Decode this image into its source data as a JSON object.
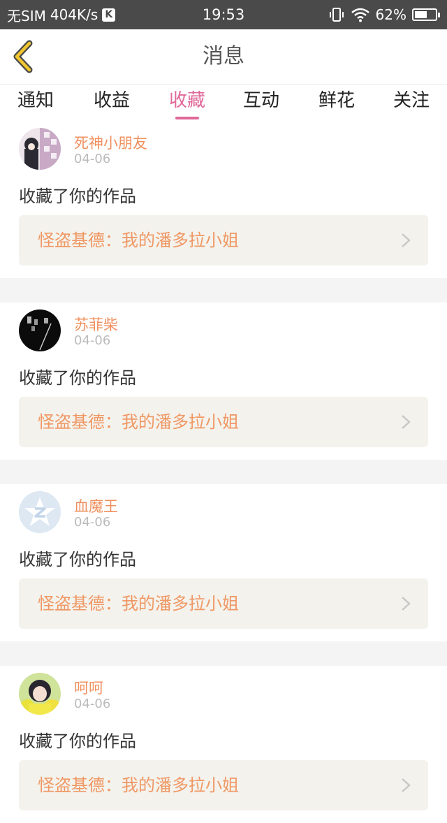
{
  "status_bar": {
    "carrier": "无SIM",
    "speed": "404K/s",
    "k_badge": "K",
    "time": "19:53",
    "battery": "62%",
    "battery_level": 0.62
  },
  "header": {
    "title": "消息",
    "back_icon": "chevron-left-icon",
    "accent_color": "#f2c62f"
  },
  "tabs": [
    {
      "label": "通知",
      "active": false
    },
    {
      "label": "收益",
      "active": false
    },
    {
      "label": "收藏",
      "active": true
    },
    {
      "label": "互动",
      "active": false
    },
    {
      "label": "鲜花",
      "active": false
    },
    {
      "label": "关注",
      "active": false
    }
  ],
  "colors": {
    "tab_active": "#e0689a",
    "username": "#f0905f",
    "work_title": "#ef9865",
    "work_bg": "#f4f2ec"
  },
  "items": [
    {
      "username": "死神小朋友",
      "date": "04-06",
      "action": "收藏了你的作品",
      "work": "怪盗基德：我的潘多拉小姐"
    },
    {
      "username": "苏菲柴",
      "date": "04-06",
      "action": "收藏了你的作品",
      "work": "怪盗基德：我的潘多拉小姐"
    },
    {
      "username": "血魔王",
      "date": "04-06",
      "action": "收藏了你的作品",
      "work": "怪盗基德：我的潘多拉小姐"
    },
    {
      "username": "呵呵",
      "date": "04-06",
      "action": "收藏了你的作品",
      "work": "怪盗基德：我的潘多拉小姐"
    }
  ]
}
